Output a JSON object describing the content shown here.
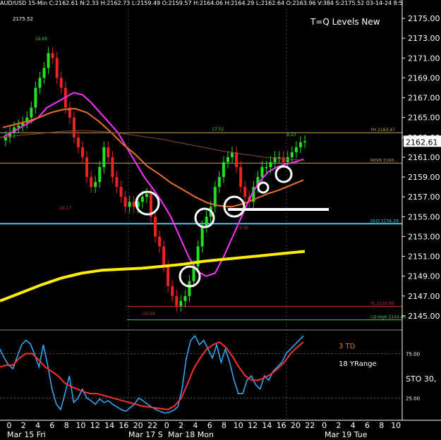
{
  "header": {
    "info": "AUD/USD 15-Min C:2162.61 N:2.33 H:2162.73 L:2159.49 O:2159.57 H:2164.06 H:2164.29 L:2162.64 O:2163.96 V:384 S:2175.52 03-14-24 8:53",
    "sub_value": "2175.52",
    "title": "T=Q Levels New"
  },
  "chart_data": [
    {
      "type": "line",
      "panel": "price",
      "title": "T=Q Levels New",
      "ylim": [
        2144,
        2176
      ],
      "yticks": [
        "2175.00",
        "2173.00",
        "2171.00",
        "2169.00",
        "2167.00",
        "2165.00",
        "2163.00",
        "2161.00",
        "2159.00",
        "2157.00",
        "2155.00",
        "2153.00",
        "2151.00",
        "2149.00",
        "2147.00",
        "2145.00"
      ],
      "last_price": "2162.61",
      "price_closes": [
        2163,
        2163.5,
        2164,
        2164.2,
        2164.5,
        2165,
        2166,
        2168,
        2169,
        2170,
        2171.5,
        2171,
        2169,
        2168,
        2166,
        2165,
        2163,
        2162,
        2161,
        2159,
        2158,
        2158.5,
        2160,
        2162,
        2161,
        2159,
        2158,
        2157,
        2156,
        2156.5,
        2156,
        2156.5,
        2157,
        2157.3,
        2155,
        2153,
        2152,
        2150,
        2148,
        2147,
        2146,
        2146.5,
        2147,
        2148.5,
        2150,
        2152,
        2154,
        2155,
        2156,
        2158,
        2159,
        2160.5,
        2161,
        2161.5,
        2160,
        2158,
        2157,
        2156.5,
        2158,
        2159,
        2160,
        2160,
        2160.5,
        2161,
        2161,
        2160.5,
        2161,
        2161.5,
        2162,
        2162.5,
        2162.61
      ],
      "series": [
        {
          "name": "",
          "color": "#ff33ff",
          "values": [
            2163,
            2163.5,
            2164,
            2164.5,
            2165,
            2166,
            2166.5,
            2167,
            2167.5,
            2167.3,
            2166.5,
            2165.5,
            2164.5,
            2163.5,
            2162,
            2160.5,
            2159,
            2157.8,
            2156.5,
            2155,
            2153,
            2151,
            2149.5,
            2149,
            2149.3,
            2151,
            2153,
            2155,
            2157,
            2158.5,
            2159.5,
            2160,
            2160.3,
            2160.5,
            2160.8
          ]
        },
        {
          "name": "",
          "color": "#e8702a",
          "values": [
            2164,
            2164.3,
            2164.6,
            2165,
            2165.5,
            2165.8,
            2165.9,
            2165.5,
            2164.6,
            2163.5,
            2162.3,
            2161.3,
            2160.1,
            2159.3,
            2158.4,
            2157.7,
            2157,
            2156.4,
            2156.1,
            2156,
            2156.3,
            2156.8,
            2157.3,
            2157.7,
            2158.2,
            2158.7
          ]
        },
        {
          "name": "",
          "color": "#8a4a2a",
          "values": [
            2163,
            2163.2,
            2163.4,
            2163.6,
            2163.7,
            2163.6,
            2163.4,
            2163.1,
            2162.8,
            2162.4,
            2162,
            2161.6,
            2161.3,
            2161,
            2160.8,
            2160.7
          ]
        },
        {
          "name": "",
          "color": "#ffee00",
          "values": [
            2146.5,
            2147.3,
            2148.1,
            2148.8,
            2149.3,
            2149.6,
            2149.7,
            2149.8,
            2150,
            2150.2,
            2150.5,
            2150.7,
            2150.9,
            2151.1,
            2151.3,
            2151.5
          ]
        }
      ],
      "levels": [
        {
          "label": "YH 2163.47",
          "value": 2163.47,
          "color": "#c8a050"
        },
        {
          "label": "R0VR 2160...",
          "value": 2160.4,
          "color": "#c8a050"
        },
        {
          "label": "OH3 2154.29",
          "value": 2154.29,
          "color": "#2fd0e0"
        },
        {
          "label": "YL 2145.95",
          "value": 2145.95,
          "color": "#d03030"
        },
        {
          "label": "LQ High 2144.60",
          "value": 2144.6,
          "color": "#44cc44"
        }
      ],
      "annotations": [
        "19.85",
        "17.52",
        "8.23",
        "-16.17",
        "-16.50",
        "-9.50"
      ]
    },
    {
      "type": "line",
      "panel": "oscillator",
      "labels": [
        "3 TD",
        "18 YRange"
      ],
      "axis_label": "STO 30,",
      "yticks": [
        "75.00",
        "25.00"
      ],
      "ylim": [
        0,
        100
      ],
      "series": [
        {
          "name": "",
          "color": "#30b0ff",
          "values": [
            80,
            70,
            62,
            58,
            72,
            85,
            90,
            86,
            74,
            60,
            85,
            62,
            35,
            18,
            12,
            30,
            50,
            20,
            25,
            35,
            25,
            22,
            18,
            24,
            20,
            22,
            18,
            15,
            12,
            10,
            14,
            18,
            25,
            22,
            18,
            15,
            12,
            10,
            8,
            9,
            11,
            15,
            35,
            70,
            90,
            95,
            85,
            90,
            80,
            70,
            85,
            65,
            80,
            65,
            45,
            30,
            30,
            45,
            50,
            40,
            35,
            50,
            45,
            55,
            60,
            65,
            75,
            80,
            85,
            90,
            95
          ]
        },
        {
          "name": "",
          "color": "#ff3030",
          "values": [
            60,
            62,
            62,
            70,
            75,
            75,
            68,
            60,
            55,
            50,
            42,
            38,
            35,
            32,
            30,
            30,
            28,
            26,
            24,
            22,
            20,
            18,
            16,
            15,
            14,
            13,
            12,
            16,
            24,
            40,
            58,
            70,
            80,
            85,
            88,
            82,
            72,
            60,
            50,
            45,
            45,
            48,
            52,
            58,
            65,
            75,
            82,
            88
          ]
        }
      ]
    }
  ],
  "xaxis": {
    "ticks": [
      "0",
      "2",
      "4",
      "6",
      "8",
      "10",
      "12",
      "14",
      "16",
      "20",
      "22",
      "0",
      "2",
      "4",
      "6",
      "8",
      "10",
      "12",
      "14",
      "16",
      "20",
      "22",
      "0",
      "2",
      "4",
      "6",
      "8",
      "10"
    ],
    "dates": [
      "Mar 15 Fri",
      "Mar 17 S",
      "Mar 18 Mon",
      "Mar 19 Tue"
    ]
  },
  "colors": {
    "background": "#000000",
    "up_candle": "#22e022",
    "down_candle": "#ee2222",
    "grid": "#444444",
    "axis_text": "#ffffff"
  }
}
